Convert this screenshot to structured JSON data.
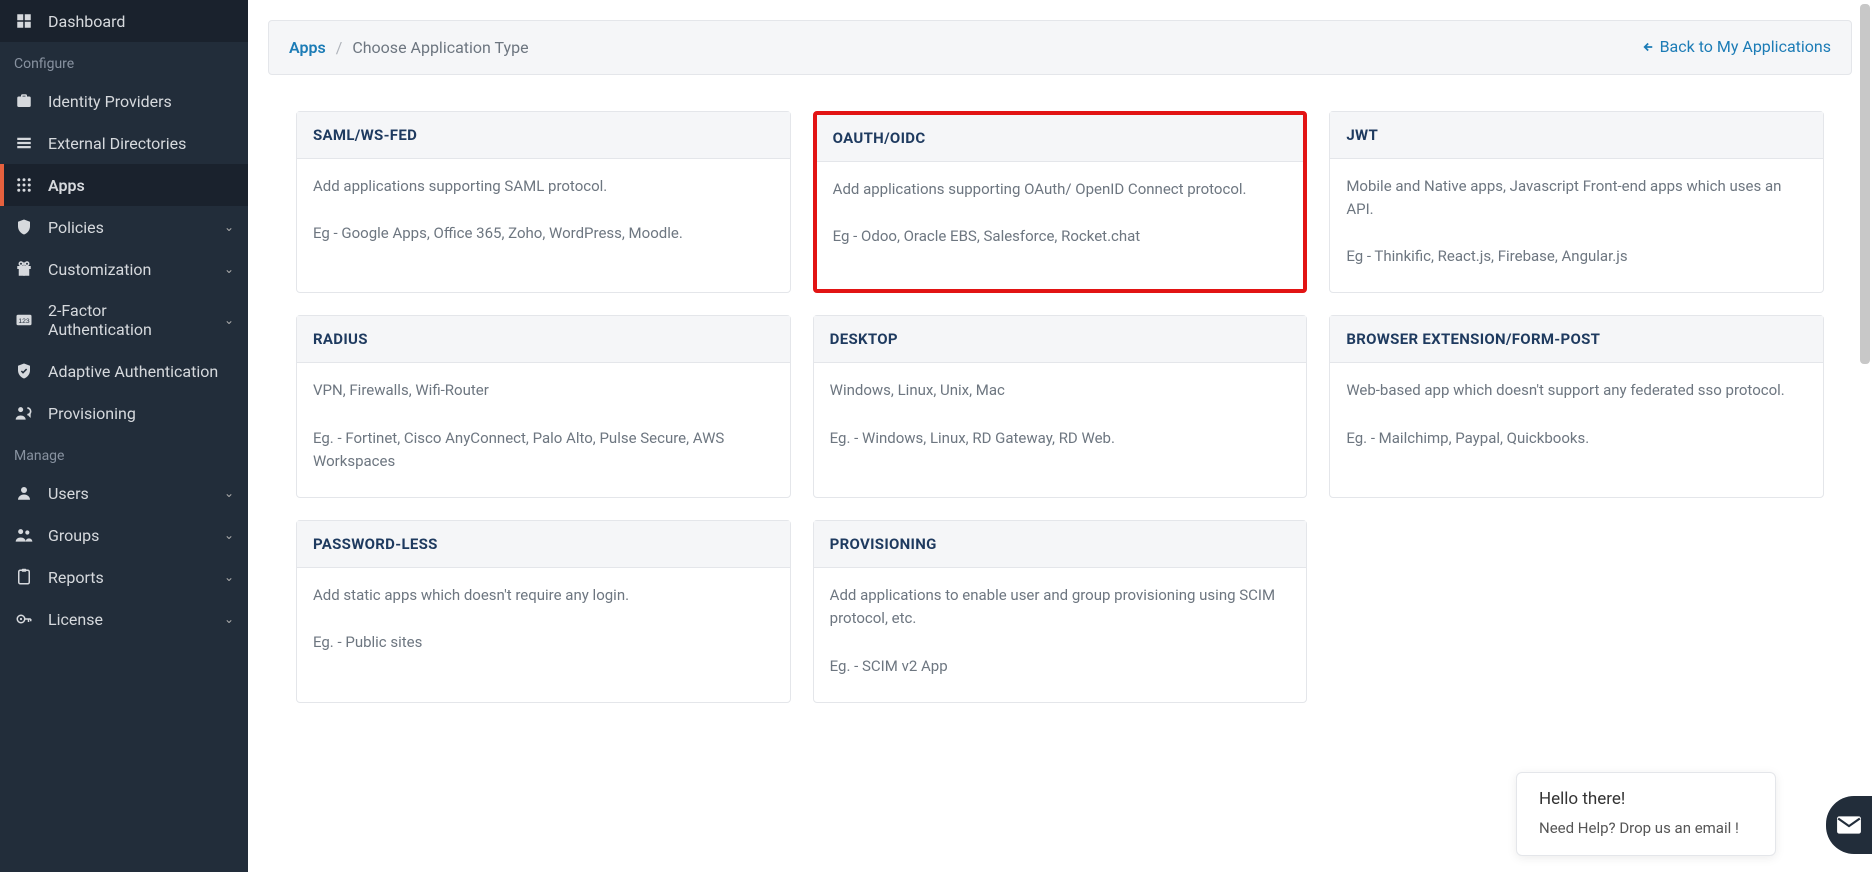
{
  "sidebar": {
    "dashboard_label": "Dashboard",
    "section_configure": "Configure",
    "idp_label": "Identity Providers",
    "ext_dirs_label": "External Directories",
    "apps_label": "Apps",
    "policies_label": "Policies",
    "customization_label": "Customization",
    "twofa_label": "2-Factor Authentication",
    "adaptive_label": "Adaptive Authentication",
    "provisioning_label": "Provisioning",
    "section_manage": "Manage",
    "users_label": "Users",
    "groups_label": "Groups",
    "reports_label": "Reports",
    "license_label": "License"
  },
  "breadcrumb": {
    "root": "Apps",
    "current": "Choose Application Type",
    "back": "Back to My Applications"
  },
  "help": {
    "title": "Hello there!",
    "subtitle": "Need Help? Drop us an email !"
  },
  "cards": {
    "saml": {
      "title": "SAML/WS-FED",
      "desc": "Add applications supporting SAML protocol.",
      "eg": "Eg - Google Apps, Office 365, Zoho, WordPress, Moodle."
    },
    "oauth": {
      "title": "OAUTH/OIDC",
      "desc": "Add applications supporting OAuth/ OpenID Connect protocol.",
      "eg": "Eg - Odoo, Oracle EBS, Salesforce, Rocket.chat"
    },
    "jwt": {
      "title": "JWT",
      "desc": "Mobile and Native apps, Javascript Front-end apps which uses an API.",
      "eg": "Eg - Thinkific, React.js, Firebase, Angular.js"
    },
    "radius": {
      "title": "RADIUS",
      "desc": "VPN, Firewalls, Wifi-Router",
      "eg": "Eg. - Fortinet, Cisco AnyConnect, Palo Alto, Pulse Secure, AWS Workspaces"
    },
    "desktop": {
      "title": "DESKTOP",
      "desc": "Windows, Linux, Unix, Mac",
      "eg": "Eg. - Windows, Linux, RD Gateway, RD Web."
    },
    "browser": {
      "title": "BROWSER EXTENSION/FORM-POST",
      "desc": "Web-based app which doesn't support any federated sso protocol.",
      "eg": "Eg. - Mailchimp, Paypal, Quickbooks."
    },
    "passwordless": {
      "title": "PASSWORD-LESS",
      "desc": "Add static apps which doesn't require any login.",
      "eg": "Eg. - Public sites"
    },
    "provisioning": {
      "title": "PROVISIONING",
      "desc": "Add applications to enable user and group provisioning using SCIM protocol, etc.",
      "eg": "Eg. - SCIM v2 App"
    }
  }
}
